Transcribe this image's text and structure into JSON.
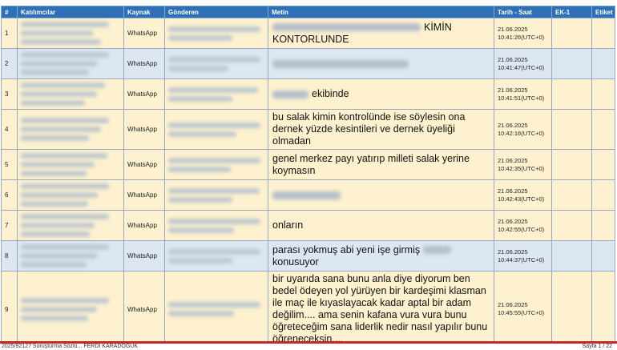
{
  "columns": [
    "#",
    "Katılımcılar",
    "Kaynak",
    "Gönderen",
    "Metin",
    "Tarih - Saat",
    "EK-1",
    "Etiket"
  ],
  "rows": [
    {
      "no": "1",
      "source": "WhatsApp",
      "text_after": "KİMİN KONTORLUNDE",
      "date": "21.06.2025",
      "time": "10:41:26(UTC+0)"
    },
    {
      "no": "2",
      "source": "WhatsApp",
      "text_after": "",
      "date": "21.06.2025",
      "time": "10:41:47(UTC+0)"
    },
    {
      "no": "3",
      "source": "WhatsApp",
      "text_after": "ekibinde",
      "date": "21.06.2025",
      "time": "10:41:51(UTC+0)"
    },
    {
      "no": "4",
      "source": "WhatsApp",
      "text_after": "bu salak kimin kontrolünde ise söylesin ona dernek yüzde kesintileri ve dernek üyeliği olmadan",
      "date": "21.06.2025",
      "time": "10:42:16(UTC+0)"
    },
    {
      "no": "5",
      "source": "WhatsApp",
      "text_after": "genel merkez payı yatırıp milleti salak yerine koymasın",
      "date": "21.06.2025",
      "time": "10:42:35(UTC+0)"
    },
    {
      "no": "6",
      "source": "WhatsApp",
      "text_after": "",
      "date": "21.06.2025",
      "time": "10:42:43(UTC+0)"
    },
    {
      "no": "7",
      "source": "WhatsApp",
      "text_after": "onların",
      "date": "21.06.2025",
      "time": "10:42:55(UTC+0)"
    },
    {
      "no": "8",
      "source": "WhatsApp",
      "text_after": "parası yokmuş abi yeni işe girmiş",
      "text_tail": "konusuyor",
      "date": "21.06.2025",
      "time": "10:44:37(UTC+0)"
    },
    {
      "no": "9",
      "source": "WhatsApp",
      "text_after": "bir uyarıda sana  bunu anla diye diyorum ben bedel ödeyen yol yürüyen bir kardeşimi klasman ile maç ile kıyaslayacak kadar aptal bir adam değilim....  ama senin kafana vura vura bunu öğreteceğim sana liderlik nedir nasıl yapılır bunu öğreneceksin....",
      "date": "21.06.2025",
      "time": "10:45:55(UTC+0)"
    }
  ],
  "footer": {
    "left": "2025/92127 Soruşturma Sözlü... FERDİ KARADOĞUK",
    "right": "Sayfa 1 / 22"
  }
}
